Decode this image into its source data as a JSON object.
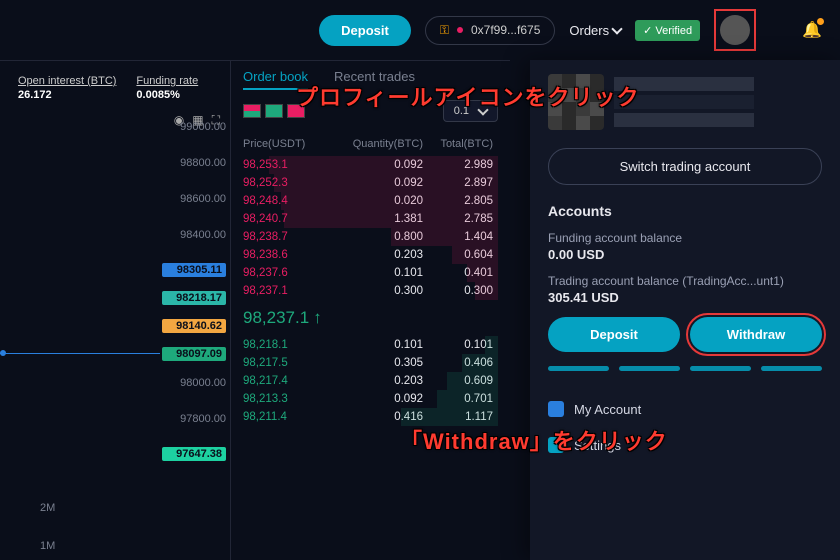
{
  "header": {
    "deposit": "Deposit",
    "wallet_addr": "0x7f99...f675",
    "orders": "Orders",
    "verified": "✓ Verified"
  },
  "stats": {
    "open_interest_label": "Open interest (BTC)",
    "open_interest_val": "26.172",
    "funding_label": "Funding rate",
    "funding_val": "0.0085%"
  },
  "yaxis": [
    "99000.00",
    "98800.00",
    "98600.00",
    "98400.00"
  ],
  "price_tags": [
    "98305.11",
    "98218.17",
    "98140.62",
    "98097.09"
  ],
  "yaxis2": [
    "98000.00",
    "97800.00"
  ],
  "last_tag": "97647.38",
  "time_axis": [
    "2M",
    "1M"
  ],
  "orderbook": {
    "tabs": {
      "orderbook": "Order book",
      "recent": "Recent trades"
    },
    "decimals": "0.1",
    "headers": {
      "price": "Price(USDT)",
      "qty": "Quantity(BTC)",
      "total": "Total(BTC)"
    },
    "sells": [
      {
        "p": "98,253.1",
        "q": "0.092",
        "t": "2.989",
        "d": 90
      },
      {
        "p": "98,252.3",
        "q": "0.092",
        "t": "2.897",
        "d": 88
      },
      {
        "p": "98,248.4",
        "q": "0.020",
        "t": "2.805",
        "d": 85
      },
      {
        "p": "98,240.7",
        "q": "1.381",
        "t": "2.785",
        "d": 84
      },
      {
        "p": "98,238.7",
        "q": "0.800",
        "t": "1.404",
        "d": 42
      },
      {
        "p": "98,238.6",
        "q": "0.203",
        "t": "0.604",
        "d": 18
      },
      {
        "p": "98,237.6",
        "q": "0.101",
        "t": "0.401",
        "d": 12
      },
      {
        "p": "98,237.1",
        "q": "0.300",
        "t": "0.300",
        "d": 9
      }
    ],
    "mid": "98,237.1",
    "buys": [
      {
        "p": "98,218.1",
        "q": "0.101",
        "t": "0.101",
        "d": 5
      },
      {
        "p": "98,217.5",
        "q": "0.305",
        "t": "0.406",
        "d": 14
      },
      {
        "p": "98,217.4",
        "q": "0.203",
        "t": "0.609",
        "d": 20
      },
      {
        "p": "98,213.3",
        "q": "0.092",
        "t": "0.701",
        "d": 24
      },
      {
        "p": "98,211.4",
        "q": "0.416",
        "t": "1.117",
        "d": 38
      }
    ]
  },
  "sidepanel": {
    "switch": "Switch trading account",
    "accounts": "Accounts",
    "funding_label": "Funding account balance",
    "funding_val": "0.00 USD",
    "trading_label": "Trading account balance (TradingAcc...unt1)",
    "trading_val": "305.41 USD",
    "deposit": "Deposit",
    "withdraw": "Withdraw",
    "my_account": "My Account",
    "settings": "Settings"
  },
  "annotations": {
    "a1": "プロフィールアイコンをクリック",
    "a2": "「Withdraw」をクリック"
  }
}
